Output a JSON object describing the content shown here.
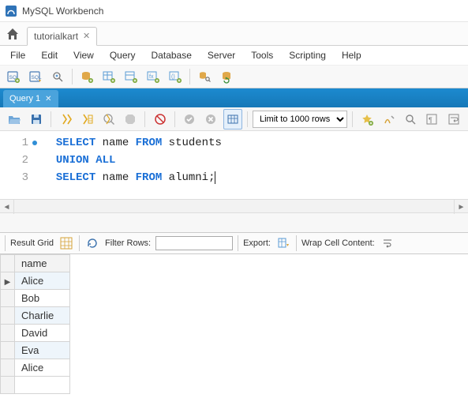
{
  "app": {
    "title": "MySQL Workbench"
  },
  "fileTab": {
    "label": "tutorialkart"
  },
  "menu": {
    "items": [
      "File",
      "Edit",
      "View",
      "Query",
      "Database",
      "Server",
      "Tools",
      "Scripting",
      "Help"
    ]
  },
  "queryTab": {
    "label": "Query 1"
  },
  "editorToolbar": {
    "limit": "Limit to 1000 rows"
  },
  "sql": {
    "lines": [
      {
        "n": "1",
        "dot": true,
        "tokens": [
          {
            "t": "kw",
            "v": "SELECT"
          },
          {
            "t": "sp",
            "v": " "
          },
          {
            "t": "plain",
            "v": "name"
          },
          {
            "t": "sp",
            "v": " "
          },
          {
            "t": "kw",
            "v": "FROM"
          },
          {
            "t": "sp",
            "v": " "
          },
          {
            "t": "plain",
            "v": "students"
          }
        ]
      },
      {
        "n": "2",
        "dot": false,
        "tokens": [
          {
            "t": "kw",
            "v": "UNION"
          },
          {
            "t": "sp",
            "v": " "
          },
          {
            "t": "kw",
            "v": "ALL"
          }
        ]
      },
      {
        "n": "3",
        "dot": false,
        "tokens": [
          {
            "t": "kw",
            "v": "SELECT"
          },
          {
            "t": "sp",
            "v": " "
          },
          {
            "t": "plain",
            "v": "name"
          },
          {
            "t": "sp",
            "v": " "
          },
          {
            "t": "kw",
            "v": "FROM"
          },
          {
            "t": "sp",
            "v": " "
          },
          {
            "t": "plain",
            "v": "alumni;"
          }
        ],
        "cursorAfter": true
      }
    ]
  },
  "resultToolbar": {
    "gridLabel": "Result Grid",
    "filterLabel": "Filter Rows:",
    "exportLabel": "Export:",
    "wrapLabel": "Wrap Cell Content:"
  },
  "results": {
    "columns": [
      "name"
    ],
    "rows": [
      "Alice",
      "Bob",
      "Charlie",
      "David",
      "Eva",
      "Alice"
    ]
  }
}
